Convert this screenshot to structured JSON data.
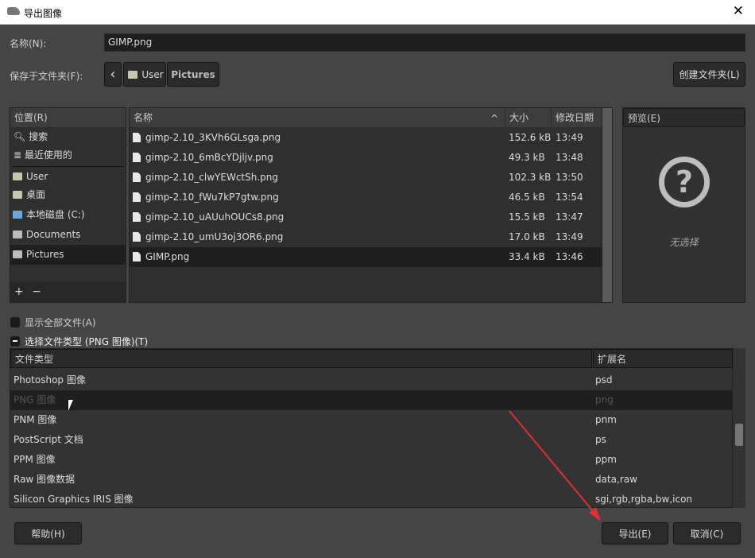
{
  "window": {
    "title": "导出图像",
    "close": "✕"
  },
  "name_label": "名称(N):",
  "name_value": "GIMP.png",
  "folder_label": "保存于文件夹(F):",
  "breadcrumb": {
    "back": "‹",
    "items": [
      "User",
      "Pictures"
    ]
  },
  "create_folder": "创建文件夹(L)",
  "places": {
    "header": "位置(R)",
    "items": [
      "搜索",
      "最近使用的",
      "User",
      "桌面",
      "本地磁盘 (C:)",
      "Documents",
      "Pictures"
    ],
    "add": "+",
    "remove": "−"
  },
  "files": {
    "columns": [
      "名称",
      "大小",
      "修改日期"
    ],
    "sort_icon": "^",
    "rows": [
      {
        "name": "gimp-2.10_3KVh6GLsga.png",
        "size": "152.6 kB",
        "date": "13:49"
      },
      {
        "name": "gimp-2.10_6mBcYDjljv.png",
        "size": "49.3 kB",
        "date": "13:48"
      },
      {
        "name": "gimp-2.10_clwYEWctSh.png",
        "size": "102.3 kB",
        "date": "13:50"
      },
      {
        "name": "gimp-2.10_fWu7kP7gtw.png",
        "size": "46.5 kB",
        "date": "13:54"
      },
      {
        "name": "gimp-2.10_uAUuhOUCs8.png",
        "size": "15.5 kB",
        "date": "13:47"
      },
      {
        "name": "gimp-2.10_umU3oj3OR6.png",
        "size": "17.0 kB",
        "date": "13:49"
      },
      {
        "name": "GIMP.png",
        "size": "33.4 kB",
        "date": "13:46"
      }
    ]
  },
  "preview": {
    "header": "预览(E)",
    "icon": "?",
    "empty": "无选择"
  },
  "show_all": "显示全部文件(A)",
  "file_type_toggle": "选择文件类型 (PNG 图像)(T)",
  "types": {
    "columns": [
      "文件类型",
      "扩展名"
    ],
    "rows": [
      {
        "type": "Photoshop 图像",
        "ext": "psd"
      },
      {
        "type": "PNG 图像",
        "ext": "png"
      },
      {
        "type": "PNM 图像",
        "ext": "pnm"
      },
      {
        "type": "PostScript 文档",
        "ext": "ps"
      },
      {
        "type": "PPM 图像",
        "ext": "ppm"
      },
      {
        "type": "Raw 图像数据",
        "ext": "data,raw"
      },
      {
        "type": "Silicon Graphics IRIS 图像",
        "ext": "sgi,rgb,rgba,bw,icon"
      }
    ]
  },
  "buttons": {
    "help": "帮助(H)",
    "export": "导出(E)",
    "cancel": "取消(C)"
  },
  "colors": {
    "annotation_arrow": "#e03030"
  }
}
